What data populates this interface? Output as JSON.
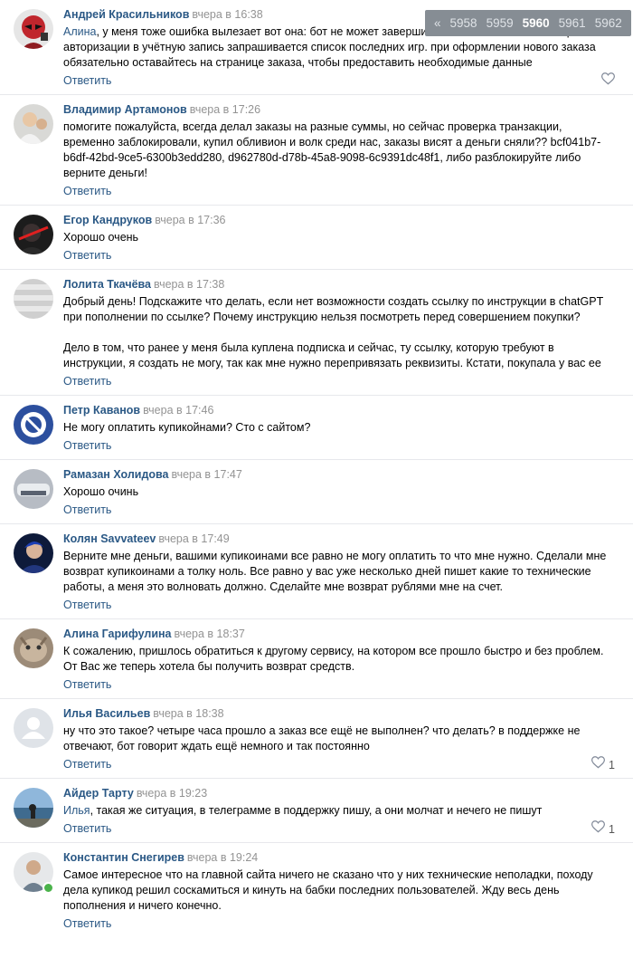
{
  "reply_label": "Ответить",
  "pagination": {
    "prev": "«",
    "pages": [
      "5958",
      "5959",
      "5960",
      "5961",
      "5962"
    ],
    "current": "5960"
  },
  "comments": [
    {
      "author": "Андрей Красильников",
      "time": "вчера в 16:38",
      "mention": "Алина",
      "text": ", у меня тоже ошибка вылезает вот она: бот не может завершить выполнение заказа — при авторизации в учётную запись запрашивается список последних игр. при оформлении нового заказа обязательно оставайтесь на странице заказа, чтобы предоставить необходимые данные",
      "likes": "",
      "avatar": "deadpool-avatar"
    },
    {
      "author": "Владимир Артамонов",
      "time": "вчера в 17:26",
      "mention": "",
      "text": "помогите пожалуйста, всегда делал заказы на разные суммы, но сейчас проверка транзакции, временно заблокировали, купил обливион и волк среди нас, заказы висят а деньги сняли?? bcf041b7-b6df-42bd-9ce5-6300b3edd280, d962780d-d78b-45a8-9098-6c9391dc48f1, либо разблокируйте либо верните деньги!",
      "likes": "",
      "avatar": "photo-avatar"
    },
    {
      "author": "Егор Кандруков",
      "time": "вчера в 17:36",
      "mention": "",
      "text": "Хорошо очень",
      "likes": "",
      "avatar": "photo-avatar"
    },
    {
      "author": "Лолита Ткачёва",
      "time": "вчера в 17:38",
      "mention": "",
      "text": "Добрый день! Подскажите что делать, если нет возможности создать ссылку по инструкции в chatGPT при пополнении по ссылке? Почему инструкцию нельзя посмотреть перед совершением покупки?\n\nДело в том, что ранее у меня была куплена подписка и сейчас, ту ссылку, которую требуют в инструкции, я создать не могу, так как мне нужно перепривязать реквизиты. Кстати, покупала у вас ее",
      "likes": "",
      "avatar": "photo-avatar"
    },
    {
      "author": "Петр Каванов",
      "time": "вчера в 17:46",
      "mention": "",
      "text": "Не могу оплатить купикойнами? Сто с сайтом?",
      "likes": "",
      "avatar": "photo-avatar"
    },
    {
      "author": "Рамазан Холидова",
      "time": "вчера в 17:47",
      "mention": "",
      "text": "Хорошо очинь",
      "likes": "",
      "avatar": "photo-avatar"
    },
    {
      "author": "Колян Savvateev",
      "time": "вчера в 17:49",
      "mention": "",
      "text": "Верните мне деньги, вашими купикоинами все равно не могу оплатить то что мне нужно. Сделали мне возврат купикоинами а толку ноль. Все равно у вас уже несколько дней пишет какие то технические работы, а меня это волновать должно. Сделайте мне возврат рублями мне на счет.",
      "likes": "",
      "avatar": "photo-avatar"
    },
    {
      "author": "Алина Гарифулина",
      "time": "вчера в 18:37",
      "mention": "",
      "text": "К сожалению, пришлось обратиться к другому сервису, на котором все прошло быстро и без проблем. От Вас же теперь хотела бы получить возврат средств.",
      "likes": "",
      "avatar": "photo-avatar"
    },
    {
      "author": "Илья Васильев",
      "time": "вчера в 18:38",
      "mention": "",
      "text": "ну что это такое? четыре часа прошло а заказ все ещё не выполнен? что делать? в поддержке не отвечают, бот говорит ждать ещё немного и так постоянно",
      "likes": "1",
      "avatar": "default-user-avatar"
    },
    {
      "author": "Айдер Тарту",
      "time": "вчера в 19:23",
      "mention": "Илья",
      "text": ", такая же ситуация, в телеграмме в поддержку пишу, а они молчат и нечего не пишут",
      "likes": "1",
      "avatar": "photo-avatar"
    },
    {
      "author": "Константин Снегирев",
      "time": "вчера в 19:24",
      "mention": "",
      "text": "Самое интересное что на главной сайта ничего не сказано что у них технические неполадки, походу дела купикод решил соскамиться и кинуть на бабки последних пользователей. Жду весь день пополнения и ничего конечно.",
      "likes": "",
      "avatar": "photo-avatar",
      "online": true
    }
  ],
  "colors": {
    "link": "#2a5885",
    "muted": "#939393",
    "divider": "#e7e8ec",
    "online": "#4bb34b",
    "pager_bg": "#868d94"
  }
}
